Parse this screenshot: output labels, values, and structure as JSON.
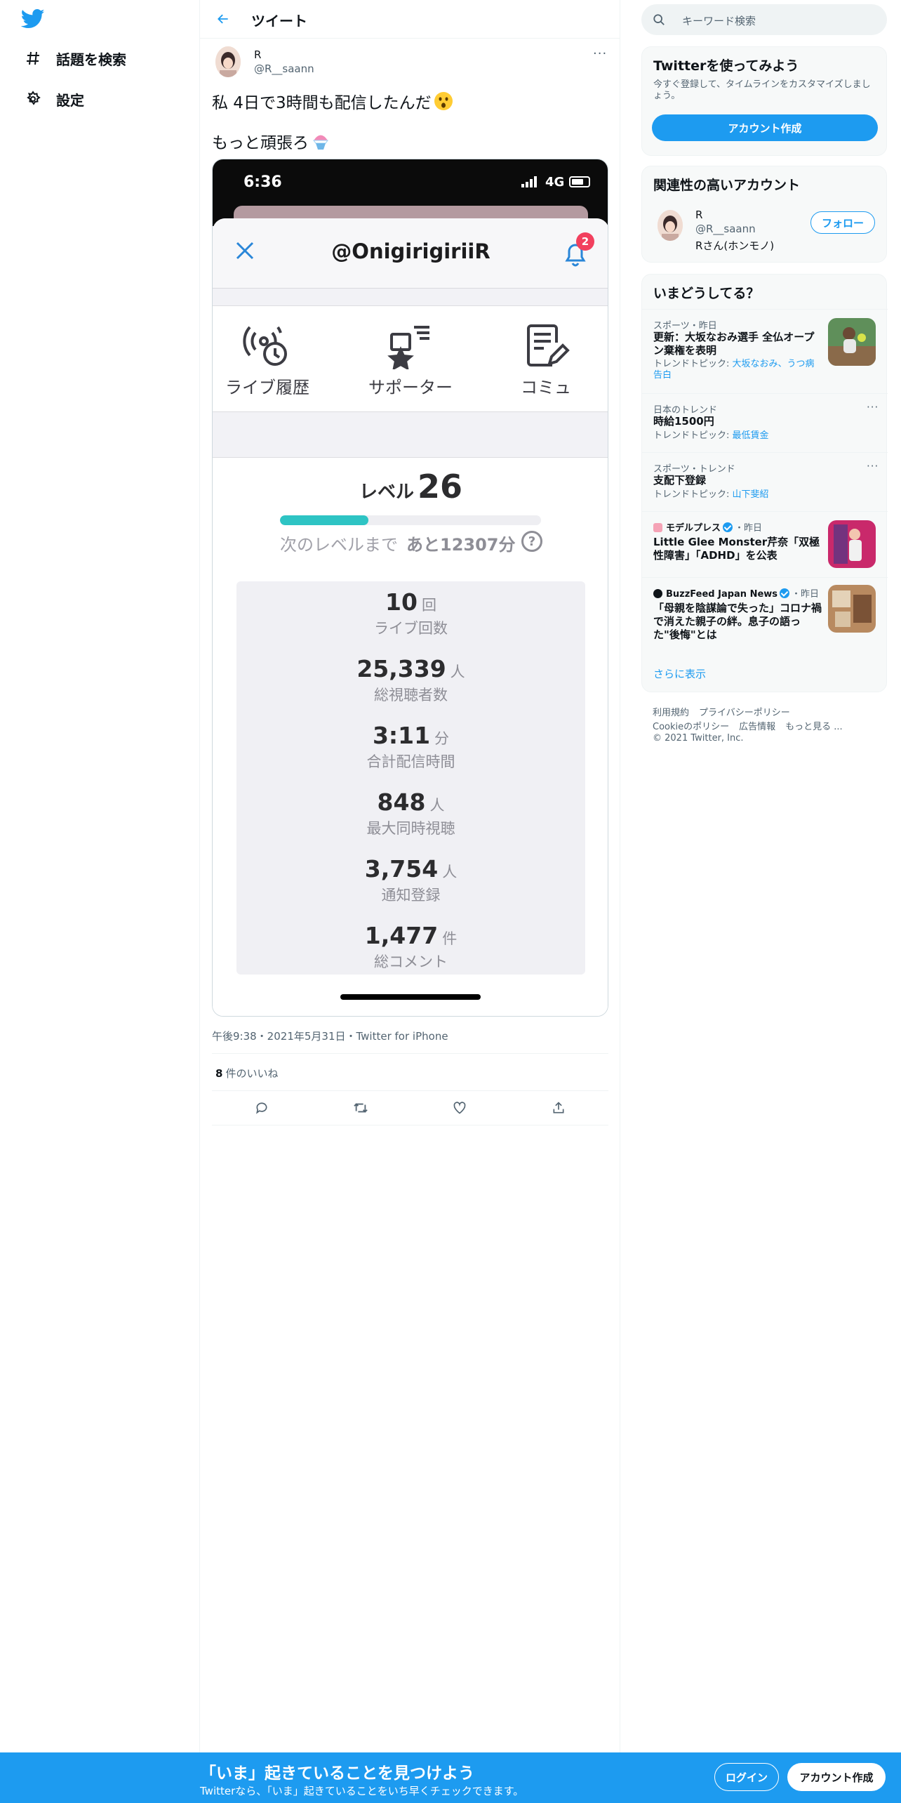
{
  "sidebar": {
    "logo_icon": "twitter-bird-icon",
    "items": [
      {
        "icon": "hashtag-icon",
        "label": "話題を検索"
      },
      {
        "icon": "gear-icon",
        "label": "設定"
      }
    ]
  },
  "header": {
    "title": "ツイート",
    "back_icon": "arrow-left-icon"
  },
  "tweet": {
    "author_name": "R",
    "author_handle": "@R__saann",
    "more": "···",
    "line1": "私 4日で3時間も配信したんだ",
    "line1_emoji": "astonished-face-emoji",
    "line2": "もっと頑張ろ",
    "line2_emoji": "shaved-ice-emoji",
    "meta": "午後9:38・2021年5月31日・Twitter for iPhone",
    "likes_count": "8",
    "likes_label": "件のいいね"
  },
  "screenshot": {
    "time": "6:36",
    "network": "4G",
    "title": "@OnigirigiriiR",
    "badge": "2",
    "tabs": [
      "ライブ履歴",
      "サポーター",
      "コミュ"
    ],
    "level_label": "レベル",
    "level_value": "26",
    "level_progress": 0.34,
    "next_label": "次のレベルまで",
    "next_value": "あと12307分",
    "help": "?",
    "stats": [
      {
        "value": "10",
        "unit": "回",
        "label": "ライブ回数"
      },
      {
        "value": "25,339",
        "unit": "人",
        "label": "総視聴者数"
      },
      {
        "value": "3:11",
        "unit": "分",
        "label": "合計配信時間"
      },
      {
        "value": "848",
        "unit": "人",
        "label": "最大同時視聴"
      },
      {
        "value": "3,754",
        "unit": "人",
        "label": "通知登録"
      },
      {
        "value": "1,477",
        "unit": "件",
        "label": "総コメント"
      }
    ]
  },
  "right": {
    "search_placeholder": "キーワード検索",
    "signup_card": {
      "title": "Twitterを使ってみよう",
      "subtitle": "今すぐ登録して、タイムラインをカスタマイズしましょう。",
      "button": "アカウント作成"
    },
    "related": {
      "title": "関連性の高いアカウント",
      "name": "R",
      "handle": "@R__saann",
      "bio": "Rさん(ホンモノ)",
      "follow": "フォロー"
    },
    "trends": {
      "title": "いまどうしてる？",
      "items": [
        {
          "context": "スポーツ・昨日",
          "title": "更新：大坂なおみ選手 全仏オープン棄権を表明",
          "tags_prefix": "トレンドトピック: ",
          "tags": "大坂なおみ、うつ病告白"
        },
        {
          "context": "日本のトレンド",
          "title": "時給1500円",
          "tags_prefix": "トレンドトピック: ",
          "tags": "最低賃金"
        },
        {
          "context": "スポーツ・トレンド",
          "title": "支配下登録",
          "tags_prefix": "トレンドトピック: ",
          "tags": "山下斐紹"
        },
        {
          "source": "モデルプレス",
          "time": "・昨日",
          "title": "Little Glee Monster芹奈「双極性障害」「ADHD」を公表"
        },
        {
          "source": "BuzzFeed Japan News",
          "time": "・昨日",
          "title": "「母親を陰謀論で失った」コロナ禍で消えた親子の絆。息子の語った\"後悔\"とは"
        }
      ],
      "show_more": "さらに表示"
    },
    "footer": {
      "line1": [
        "利用規約",
        "プライバシーポリシー"
      ],
      "line2": [
        "Cookieのポリシー",
        "広告情報",
        "もっと見る ..."
      ],
      "copyright": "© 2021 Twitter, Inc."
    }
  },
  "bottom_bar": {
    "title": "「いま」起きていることを見つけよう",
    "subtitle": "Twitterなら、「いま」起きていることをいち早くチェックできます。",
    "login": "ログイン",
    "signup": "アカウント作成"
  },
  "colors": {
    "accent": "#1d9bf0",
    "progress": "#2ec4c4",
    "badge": "#f2405e"
  }
}
